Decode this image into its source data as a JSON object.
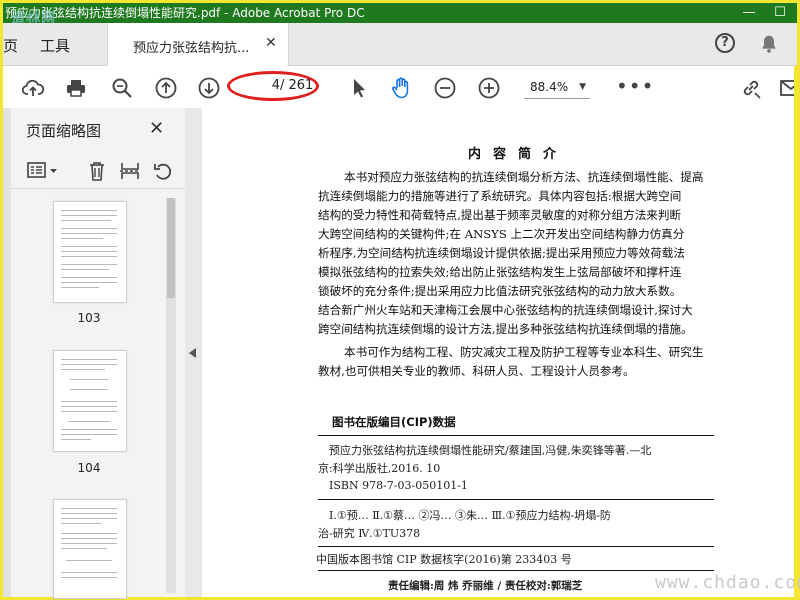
{
  "window": {
    "title": "预应力张弦结构抗连续倒塌性能研究.pdf - Adobe Acrobat Pro DC",
    "logo_watermark": "道林网",
    "minimize": "—",
    "maximize": "☐"
  },
  "tabs": {
    "prev": "页",
    "tools": "工具",
    "active": "预应力张弦结构抗...",
    "close": "✕"
  },
  "header_icons": {
    "help": "?"
  },
  "toolbar": {
    "current_page": "4",
    "total_pages": "/ 261",
    "zoom": "88.4%",
    "zoom_caret": "▼",
    "more": "•••"
  },
  "sidebar": {
    "title": "页面缩略图",
    "close": "✕",
    "thumbnails": [
      {
        "label": "103"
      },
      {
        "label": "104"
      }
    ]
  },
  "document": {
    "heading": "内容简介",
    "para1": [
      "本书对预应力张弦结构的抗连续倒塌分析方法、抗连续倒塌性能、提高",
      "抗连续倒塌能力的措施等进行了系统研究。具体内容包括:根据大跨空间",
      "结构的受力特性和荷载特点,提出基于频率灵敏度的对称分组方法来判断",
      "大跨空间结构的关键构件;在 ANSYS 上二次开发出空间结构静力仿真分",
      "析程序,为空间结构抗连续倒塌设计提供依据;提出采用预应力等效荷载法",
      "模拟张弦结构的拉索失效;给出防止张弦结构发生上弦局部破坏和撑杆连",
      "锁破坏的充分条件;提出采用应力比值法研究张弦结构的动力放大系数。",
      "结合新广州火车站和天津梅江会展中心张弦结构的抗连续倒塌设计,探讨大",
      "跨空间结构抗连续倒塌的设计方法,提出多种张弦结构抗连续倒塌的措施。"
    ],
    "para2": [
      "本书可作为结构工程、防灾减灾工程及防护工程等专业本科生、研究生",
      "教材,也可供相关专业的教师、科研人员、工程设计人员参考。"
    ],
    "cip_title": "图书在版编目(CIP)数据",
    "cip_lines": [
      "预应力张弦结构抗连续倒塌性能研究/蔡建国,冯健,朱奕锋等著.—北",
      "京:科学出版社,2016. 10",
      "ISBN 978-7-03-050101-1",
      "Ⅰ.①预…   Ⅱ.①蔡…   ②冯…   ③朱…   Ⅲ.①预应力结构-坍塌-防",
      "治-研究   Ⅳ.①TU378",
      "中国版本图书馆 CIP 数据核字(2016)第 233403 号",
      "责任编辑:周  炜  乔丽维 / 责任校对:郭瑞芝"
    ]
  },
  "site_watermark": "www.chdao.com"
}
